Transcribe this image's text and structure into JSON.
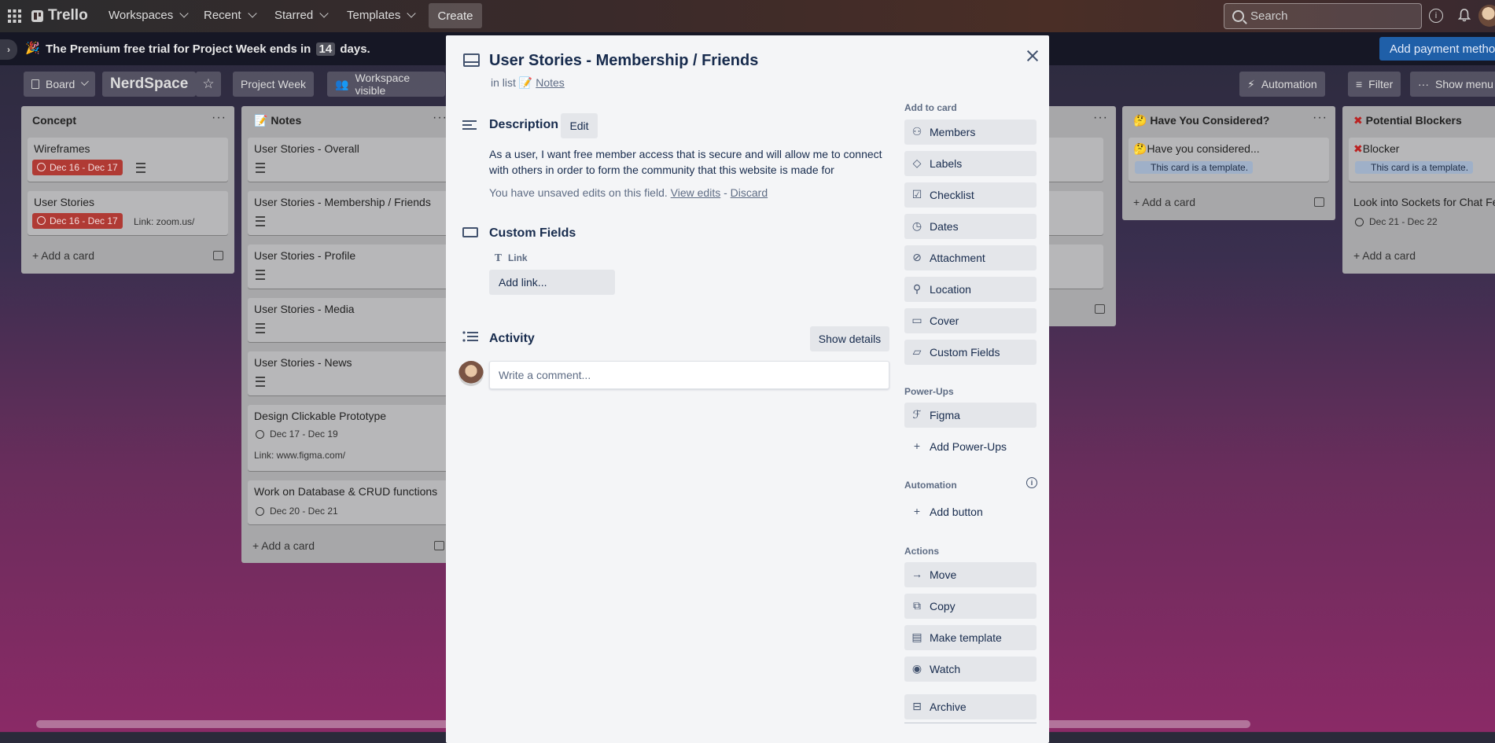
{
  "topbar": {
    "brand": "Trello",
    "nav": [
      {
        "label": "Workspaces"
      },
      {
        "label": "Recent"
      },
      {
        "label": "Starred"
      },
      {
        "label": "Templates"
      }
    ],
    "create_label": "Create",
    "search_placeholder": "Search"
  },
  "banner": {
    "message_prefix": "The Premium free trial for Project Week ends in",
    "days": "14",
    "message_suffix": "days.",
    "cta": "Add payment method"
  },
  "boardbar": {
    "view_label": "Board",
    "board_name": "NerdSpace",
    "project_week": "Project Week",
    "visibility": "Workspace visible",
    "automation": "Automation",
    "filter": "Filter",
    "show_menu": "Show menu"
  },
  "lists": {
    "concept": {
      "title": "Concept",
      "cards": [
        {
          "title": "Wireframes",
          "date": "Dec 16 - Dec 17"
        },
        {
          "title": "User Stories",
          "date": "Dec 16 - Dec 17",
          "link": "Link: zoom.us/"
        }
      ],
      "add": "Add a card"
    },
    "notes": {
      "title": "Notes",
      "cards": [
        {
          "title": "User Stories - Overall"
        },
        {
          "title": "User Stories - Membership / Friends"
        },
        {
          "title": "User Stories - Profile"
        },
        {
          "title": "User Stories - Media"
        },
        {
          "title": "User Stories - News"
        },
        {
          "title": "Design Clickable Prototype",
          "date": "Dec 17 - Dec 19",
          "link": "Link: www.figma.com/"
        },
        {
          "title": "Work on Database & CRUD functions",
          "date": "Dec 20 - Dec 21"
        }
      ],
      "add": "Add a card"
    },
    "considered": {
      "title": "Have You Considered?",
      "cards": [
        {
          "title": "Have you considered...",
          "template": "This card is a template."
        }
      ],
      "add": "Add a card"
    },
    "blockers": {
      "title": "Potential Blockers",
      "cards": [
        {
          "title": "Blocker",
          "template": "This card is a template."
        },
        {
          "title": "Look into Sockets for Chat Fe",
          "date": "Dec 21 - Dec 22"
        }
      ],
      "add": "Add a card"
    }
  },
  "modal": {
    "title": "User Stories - Membership / Friends",
    "in_list_prefix": "in list",
    "list_name": "Notes",
    "description_heading": "Description",
    "edit_label": "Edit",
    "description_text": "As a user, I want free member access that is secure and will allow me to connect with others in order to form the community that this website is made for",
    "unsaved_text": "You have unsaved edits on this field.",
    "view_edits": "View edits",
    "separator": "-",
    "discard": "Discard",
    "custom_fields_heading": "Custom Fields",
    "field_label": "Link",
    "add_link": "Add link...",
    "activity_heading": "Activity",
    "show_details": "Show details",
    "comment_placeholder": "Write a comment...",
    "sidebar": {
      "add_to_card": "Add to card",
      "members": "Members",
      "labels": "Labels",
      "checklist": "Checklist",
      "dates": "Dates",
      "attachment": "Attachment",
      "location": "Location",
      "cover": "Cover",
      "custom_fields": "Custom Fields",
      "power_ups": "Power-Ups",
      "figma": "Figma",
      "add_power_ups": "Add Power-Ups",
      "automation": "Automation",
      "add_button": "Add button",
      "actions": "Actions",
      "move": "Move",
      "copy": "Copy",
      "make_template": "Make template",
      "watch": "Watch",
      "archive": "Archive"
    }
  },
  "colors": {
    "accent": "#1f5fa8",
    "date_overdue": "#b03a34",
    "modal_bg": "#f4f5f7"
  }
}
